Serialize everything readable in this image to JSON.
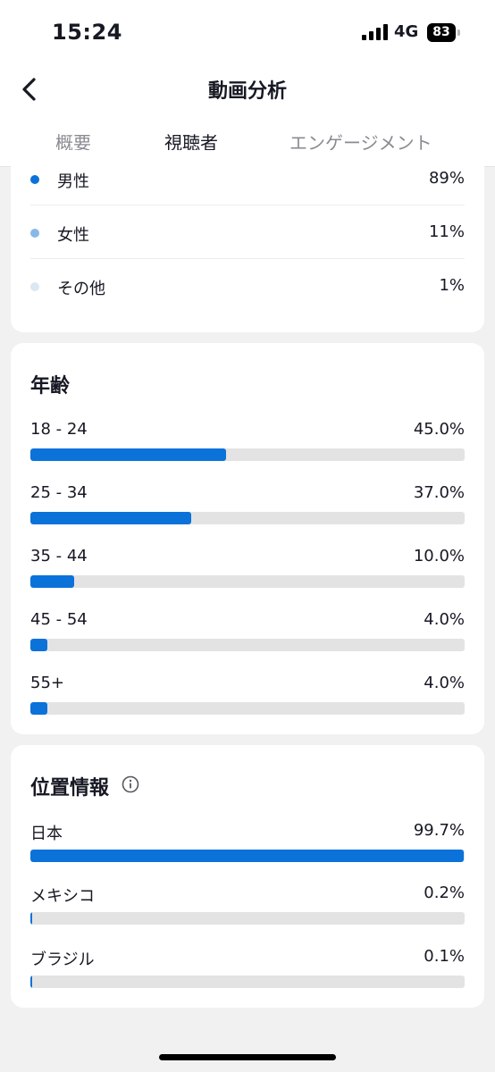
{
  "status_bar": {
    "time": "15:24",
    "network": "4G",
    "battery": "83"
  },
  "header": {
    "title": "動画分析"
  },
  "tabs": [
    {
      "label": "概要",
      "active": false
    },
    {
      "label": "視聴者",
      "active": true
    },
    {
      "label": "エンゲージメント",
      "active": false
    }
  ],
  "gender": {
    "items": [
      {
        "label": "男性",
        "value": "89%",
        "color": "#0b72d9"
      },
      {
        "label": "女性",
        "value": "11%",
        "color": "#89b8e8"
      },
      {
        "label": "その他",
        "value": "1%",
        "color": "#dbe7f3"
      }
    ]
  },
  "age": {
    "title": "年齢",
    "rows": [
      {
        "label": "18 - 24",
        "value": "45.0%",
        "percent": 45.0
      },
      {
        "label": "25 - 34",
        "value": "37.0%",
        "percent": 37.0
      },
      {
        "label": "35 - 44",
        "value": "10.0%",
        "percent": 10.0
      },
      {
        "label": "45 - 54",
        "value": "4.0%",
        "percent": 4.0
      },
      {
        "label": "55+",
        "value": "4.0%",
        "percent": 4.0
      }
    ]
  },
  "location": {
    "title": "位置情報",
    "rows": [
      {
        "label": "日本",
        "value": "99.7%",
        "percent": 99.7
      },
      {
        "label": "メキシコ",
        "value": "0.2%",
        "percent": 0.2
      },
      {
        "label": "ブラジル",
        "value": "0.1%",
        "percent": 0.1
      }
    ]
  },
  "colors": {
    "accent": "#0b72d9",
    "track": "#e3e3e4",
    "background": "#f1f1f2"
  }
}
